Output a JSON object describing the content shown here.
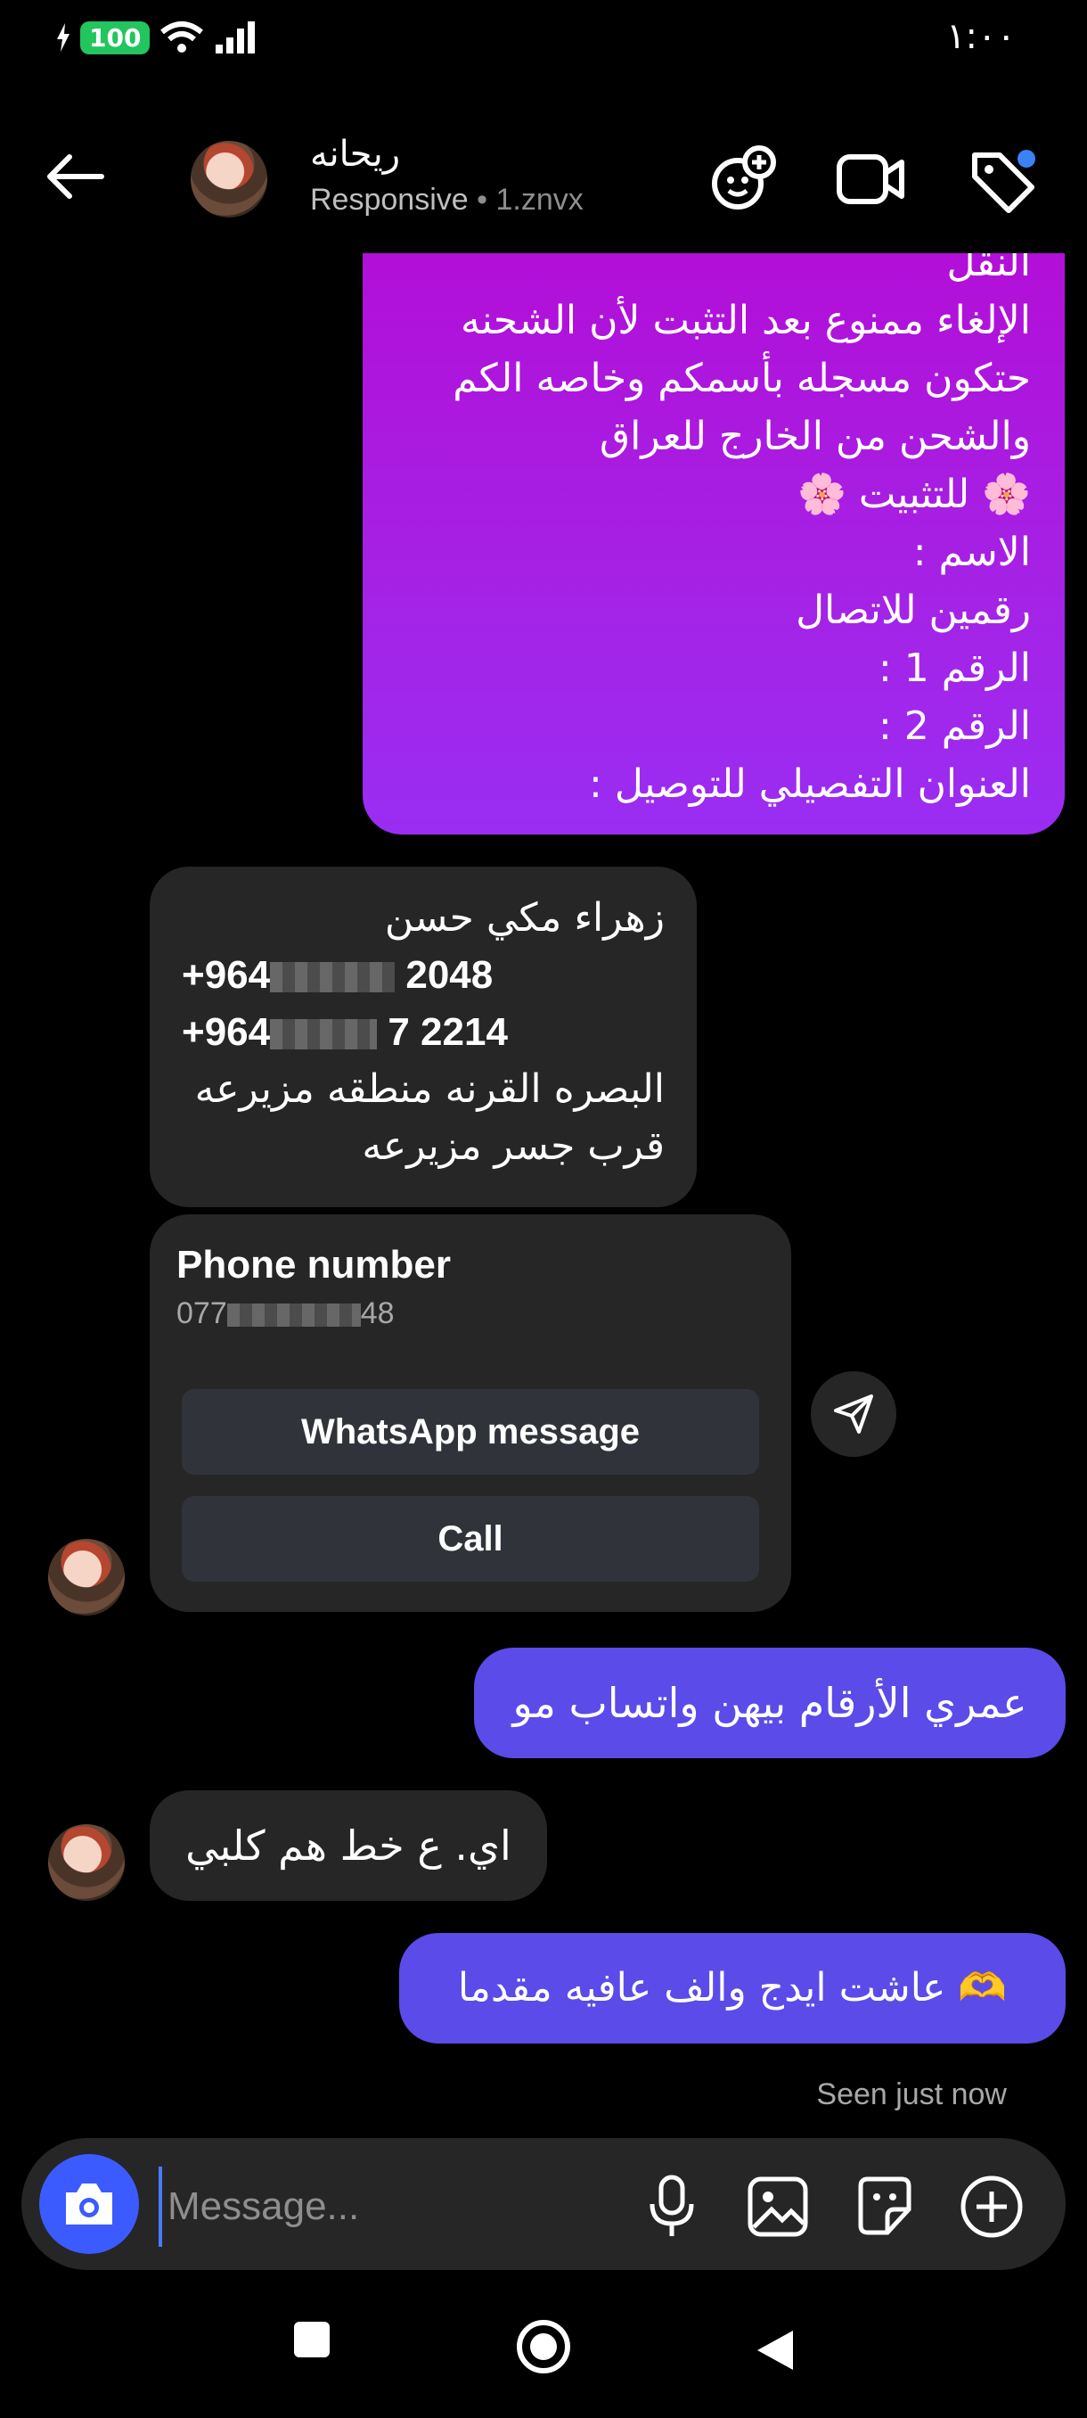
{
  "status_bar": {
    "battery": "100",
    "time": "١:٠٠"
  },
  "header": {
    "contact_name": "ريحانه",
    "subtitle_status": "Responsive",
    "subtitle_separator": "•",
    "subtitle_username": "1.znvx"
  },
  "messages": {
    "outgoing_info_lines": [
      "النقل",
      "الإلغاء ممنوع بعد التثبت لأن الشحنه",
      "حتكون مسجله بأسمكم وخاصه الكم",
      "والشحن من الخارج للعراق",
      "🌸 للتثبيت 🌸",
      "الاسم :",
      "رقمين للاتصال",
      "الرقم 1 :",
      "الرقم 2 :",
      "العنوان التفصيلي للتوصيل :"
    ],
    "incoming_address": {
      "name": "زهراء مكي حسن",
      "phone1_prefix": "+964",
      "phone1_suffix": "2048",
      "phone2_prefix": "+964",
      "phone2_suffix": "7 2214",
      "address1": "البصره القرنه منطقه مزيرعه",
      "address2": "قرب جسر مزيرعه"
    },
    "phone_card": {
      "title": "Phone number",
      "number_prefix": "077",
      "number_suffix": "48",
      "whatsapp_label": "WhatsApp message",
      "call_label": "Call"
    },
    "outgoing_2": "عمري الأرقام بيهن واتساب مو",
    "incoming_2": "اي. ع خط هم كلبي",
    "outgoing_3": "🫶 عاشت ايدج والف عافيه مقدما",
    "seen": "Seen just now"
  },
  "composer": {
    "placeholder": "Message..."
  }
}
